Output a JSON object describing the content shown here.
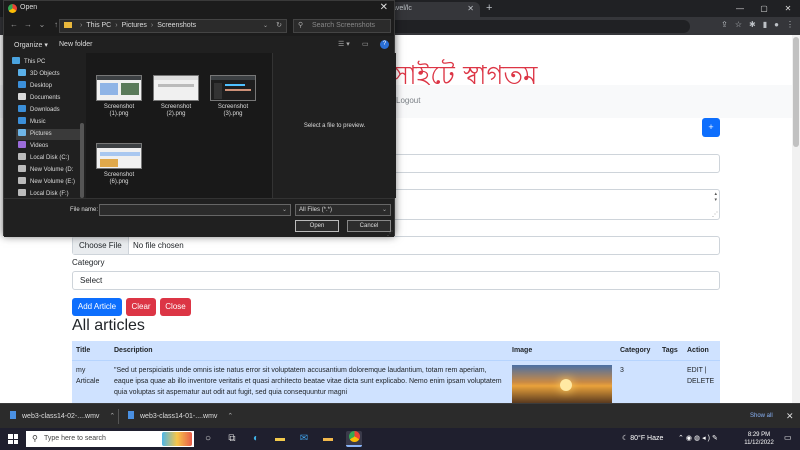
{
  "browser": {
    "tab_title": "of /web3-batch-laravel/lc",
    "omnibox": ""
  },
  "page": {
    "site_title": "সাইটে স্বাগতম",
    "nav_logout": "Logout",
    "plus_label": "+",
    "file_button": "Choose File",
    "file_status": "No file chosen",
    "category_label": "Category",
    "category_select": "Select",
    "buttons": {
      "add": "Add Article",
      "clear": "Clear",
      "close": "Close"
    },
    "articles_heading": "All articles",
    "table": {
      "headers": [
        "Title",
        "Description",
        "Image",
        "Category",
        "Tags",
        "Action"
      ],
      "rows": [
        {
          "title": "my Articale",
          "description": "\"Sed ut perspiciatis unde omnis iste natus error sit voluptatem accusantium doloremque laudantium, totam rem aperiam, eaque ipsa quae ab illo inventore veritatis et quasi architecto beatae vitae dicta sunt explicabo. Nemo enim ipsam voluptatem quia voluptas sit aspernatur aut odit aut fugit, sed quia consequuntur magni",
          "category": "3",
          "tags": "",
          "action": "EDIT | DELETE"
        }
      ]
    }
  },
  "dialog": {
    "title": "Open",
    "path": [
      "This PC",
      "Pictures",
      "Screenshots"
    ],
    "search_placeholder": "Search Screenshots",
    "organize": "Organize ▾",
    "new_folder": "New folder",
    "sidebar": [
      {
        "label": "This PC",
        "color": "#4aa3df"
      },
      {
        "label": "3D Objects",
        "color": "#5ab0e8"
      },
      {
        "label": "Desktop",
        "color": "#3b8fd9"
      },
      {
        "label": "Documents",
        "color": "#d9d9d9"
      },
      {
        "label": "Downloads",
        "color": "#3b8fd9"
      },
      {
        "label": "Music",
        "color": "#3b8fd9"
      },
      {
        "label": "Pictures",
        "color": "#6fb6e8"
      },
      {
        "label": "Videos",
        "color": "#9b6bd9"
      },
      {
        "label": "Local Disk (C:)",
        "color": "#bbbbbb"
      },
      {
        "label": "New Volume (D:",
        "color": "#bbbbbb"
      },
      {
        "label": "New Volume (E:)",
        "color": "#bbbbbb"
      },
      {
        "label": "Local Disk (F:)",
        "color": "#bbbbbb"
      }
    ],
    "files": [
      {
        "name": "Screenshot (1).png",
        "name1": "Screenshot",
        "name2": "(1).png"
      },
      {
        "name": "Screenshot (2).png",
        "name1": "Screenshot",
        "name2": "(2).png"
      },
      {
        "name": "Screenshot (3).png",
        "name1": "Screenshot",
        "name2": "(3).png"
      },
      {
        "name": "Screenshot (6).png",
        "name1": "Screenshot",
        "name2": "(6).png"
      }
    ],
    "preview_text": "Select a file to preview.",
    "file_name_label": "File name:",
    "file_name_value": "",
    "file_type": "All Files (*.*)",
    "open_button": "Open",
    "cancel_button": "Cancel"
  },
  "downloads": {
    "items": [
      "web3-class14-02-....wmv",
      "web3-class14-01-....wmv"
    ],
    "show_all": "Show all"
  },
  "taskbar": {
    "search_placeholder": "Type here to search",
    "weather": "80°F  Haze",
    "time": "8:29 PM",
    "date": "11/12/2022"
  }
}
